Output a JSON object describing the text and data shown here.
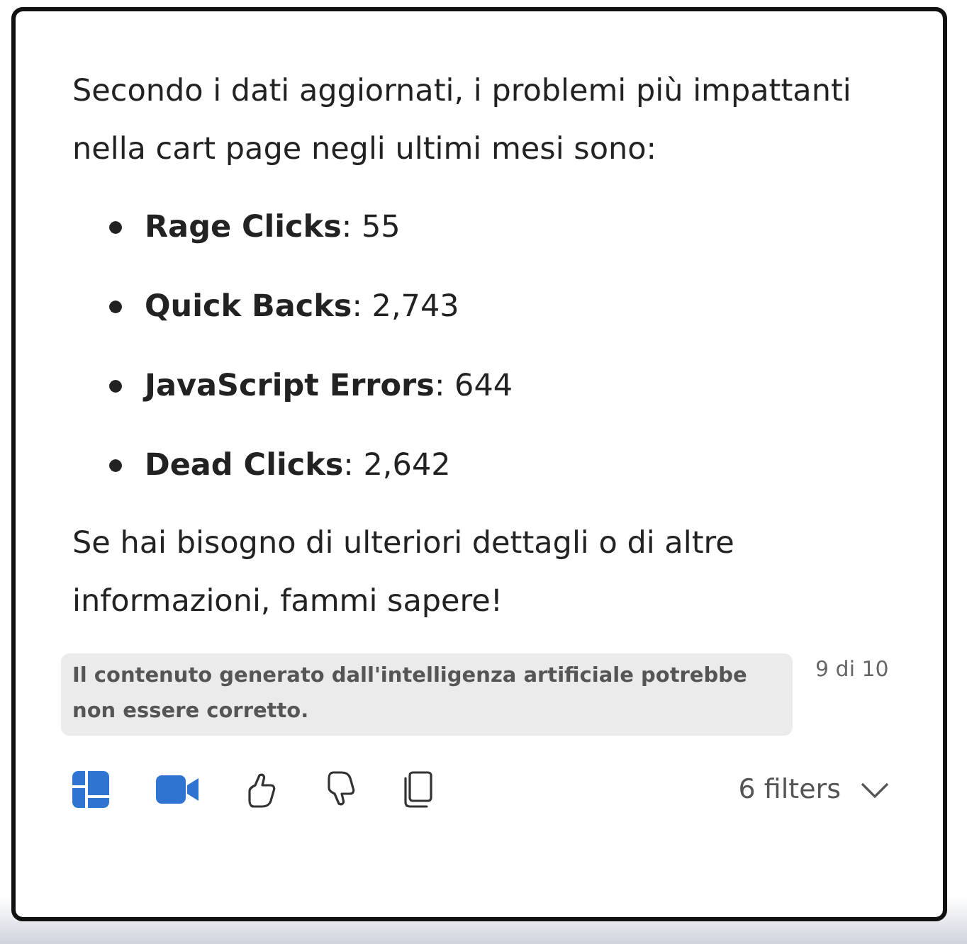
{
  "message": {
    "intro": "Secondo i dati aggiornati, i problemi più impattanti nella cart page negli ultimi mesi sono:",
    "items": [
      "**Rage Clicks**: 55",
      "**Quick Backs**: 2,743",
      "**JavaScript Errors**: 644",
      "**Dead Clicks**: 2,642"
    ],
    "outro": "Se hai bisogno di ulteriori dettagli o di altre informazioni, fammi sapere!"
  },
  "disclaimer": "Il contenuto generato dall'intelligenza artificiale potrebbe non essere corretto.",
  "counter": "9 di 10",
  "actions": [
    {
      "kind": "layout"
    },
    {
      "kind": "video"
    },
    {
      "kind": "like"
    },
    {
      "kind": "dislike"
    },
    {
      "kind": "copy"
    }
  ],
  "filters": {
    "label": "6 filters"
  }
}
